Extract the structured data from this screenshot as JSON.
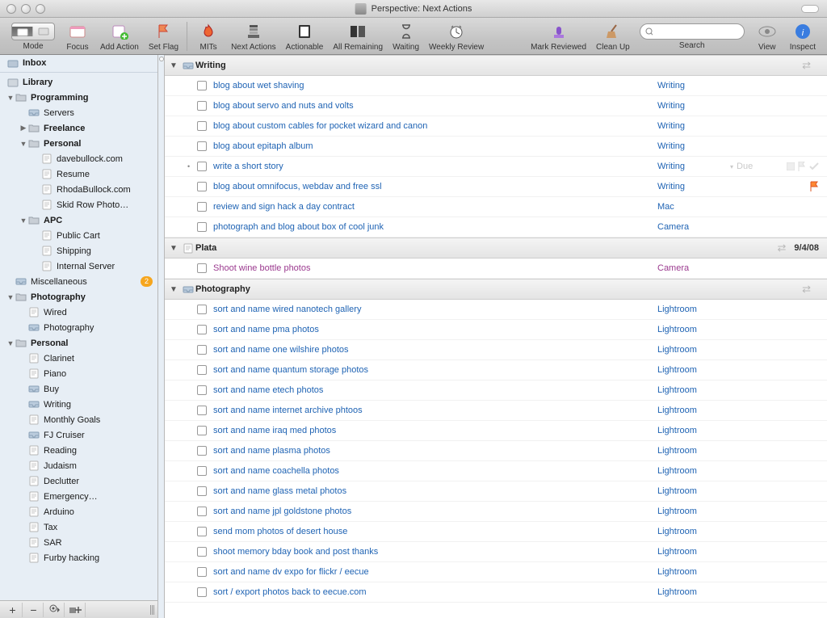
{
  "window": {
    "title": "Perspective: Next Actions"
  },
  "toolbar": {
    "mode": "Mode",
    "focus": "Focus",
    "add_action": "Add Action",
    "set_flag": "Set Flag",
    "mits": "MITs",
    "next_actions": "Next Actions",
    "actionable": "Actionable",
    "all_remaining": "All Remaining",
    "waiting": "Waiting",
    "weekly_review": "Weekly Review",
    "mark_reviewed": "Mark Reviewed",
    "clean_up": "Clean Up",
    "search": "Search",
    "view": "View",
    "inspect": "Inspect",
    "search_placeholder": ""
  },
  "sidebar": {
    "inbox": "Inbox",
    "library": "Library",
    "items": [
      {
        "label": "Programming",
        "bold": true,
        "indent": 0,
        "tri": "▼",
        "icon": "folder"
      },
      {
        "label": "Servers",
        "indent": 1,
        "icon": "tray"
      },
      {
        "label": "Freelance",
        "bold": true,
        "indent": 1,
        "tri": "▶",
        "icon": "folder"
      },
      {
        "label": "Personal",
        "bold": true,
        "indent": 1,
        "tri": "▼",
        "icon": "folder"
      },
      {
        "label": "davebullock.com",
        "indent": 2,
        "icon": "page"
      },
      {
        "label": "Resume",
        "indent": 2,
        "icon": "page"
      },
      {
        "label": "RhodaBullock.com",
        "indent": 2,
        "icon": "page"
      },
      {
        "label": "Skid Row Photo…",
        "indent": 2,
        "icon": "page"
      },
      {
        "label": "APC",
        "bold": true,
        "indent": 1,
        "tri": "▼",
        "icon": "folder"
      },
      {
        "label": "Public Cart",
        "indent": 2,
        "icon": "page"
      },
      {
        "label": "Shipping",
        "indent": 2,
        "icon": "page"
      },
      {
        "label": "Internal Server",
        "indent": 2,
        "icon": "page"
      },
      {
        "label": "Miscellaneous",
        "indent": 0,
        "icon": "tray",
        "badge": "2"
      },
      {
        "label": "Photography",
        "bold": true,
        "indent": 0,
        "tri": "▼",
        "icon": "folder"
      },
      {
        "label": "Wired",
        "indent": 1,
        "icon": "page"
      },
      {
        "label": "Photography",
        "indent": 1,
        "icon": "tray"
      },
      {
        "label": "Personal",
        "bold": true,
        "indent": 0,
        "tri": "▼",
        "icon": "folder"
      },
      {
        "label": "Clarinet",
        "indent": 1,
        "icon": "page"
      },
      {
        "label": "Piano",
        "indent": 1,
        "icon": "page"
      },
      {
        "label": "Buy",
        "indent": 1,
        "icon": "tray"
      },
      {
        "label": "Writing",
        "indent": 1,
        "icon": "tray"
      },
      {
        "label": "Monthly Goals",
        "indent": 1,
        "icon": "page"
      },
      {
        "label": "FJ Cruiser",
        "indent": 1,
        "icon": "tray"
      },
      {
        "label": "Reading",
        "indent": 1,
        "icon": "page"
      },
      {
        "label": "Judaism",
        "indent": 1,
        "icon": "page"
      },
      {
        "label": "Declutter",
        "indent": 1,
        "icon": "page"
      },
      {
        "label": "Emergency…",
        "indent": 1,
        "icon": "page"
      },
      {
        "label": "Arduino",
        "indent": 1,
        "icon": "page"
      },
      {
        "label": "Tax",
        "indent": 1,
        "icon": "page"
      },
      {
        "label": "SAR",
        "indent": 1,
        "icon": "page"
      },
      {
        "label": "Furby hacking",
        "indent": 1,
        "icon": "page"
      }
    ]
  },
  "groups": [
    {
      "name": "Writing",
      "icon": "tray",
      "date": "",
      "tasks": [
        {
          "name": "blog about wet shaving",
          "ctx": "Writing"
        },
        {
          "name": "blog about servo and nuts and volts",
          "ctx": "Writing"
        },
        {
          "name": "blog about custom cables for pocket wizard and canon",
          "ctx": "Writing"
        },
        {
          "name": "blog about epitaph album",
          "ctx": "Writing"
        },
        {
          "name": "write a short story",
          "ctx": "Writing",
          "dotted": true,
          "due": "Due",
          "flags": true
        },
        {
          "name": "blog about omnifocus, webdav and free ssl",
          "ctx": "Writing",
          "flag_orange": true
        },
        {
          "name": "review and sign hack a day contract",
          "ctx": "Mac"
        },
        {
          "name": "photograph and blog about box of cool junk",
          "ctx": "Camera"
        }
      ]
    },
    {
      "name": "Plata",
      "icon": "page",
      "date": "9/4/08",
      "tasks": [
        {
          "name": "Shoot wine bottle photos",
          "ctx": "Camera",
          "purple": true
        }
      ]
    },
    {
      "name": "Photography",
      "icon": "tray",
      "date": "",
      "tasks": [
        {
          "name": "sort and name wired nanotech gallery",
          "ctx": "Lightroom"
        },
        {
          "name": "sort and name pma photos",
          "ctx": "Lightroom"
        },
        {
          "name": "sort and name one wilshire photos",
          "ctx": "Lightroom"
        },
        {
          "name": "sort and name quantum storage photos",
          "ctx": "Lightroom"
        },
        {
          "name": "sort and name etech photos",
          "ctx": "Lightroom"
        },
        {
          "name": "sort and name internet archive phtoos",
          "ctx": "Lightroom"
        },
        {
          "name": "sort and name iraq med photos",
          "ctx": "Lightroom"
        },
        {
          "name": "sort and name plasma photos",
          "ctx": "Lightroom"
        },
        {
          "name": "sort and name coachella photos",
          "ctx": "Lightroom"
        },
        {
          "name": "sort and name glass metal photos",
          "ctx": "Lightroom"
        },
        {
          "name": "sort and name jpl goldstone photos",
          "ctx": "Lightroom"
        },
        {
          "name": "send mom photos of desert house",
          "ctx": "Lightroom"
        },
        {
          "name": "shoot memory bday book and post thanks",
          "ctx": "Lightroom"
        },
        {
          "name": "sort and name dv expo for flickr / eecue",
          "ctx": "Lightroom"
        },
        {
          "name": "sort / export photos back to eecue.com",
          "ctx": "Lightroom"
        }
      ]
    }
  ]
}
